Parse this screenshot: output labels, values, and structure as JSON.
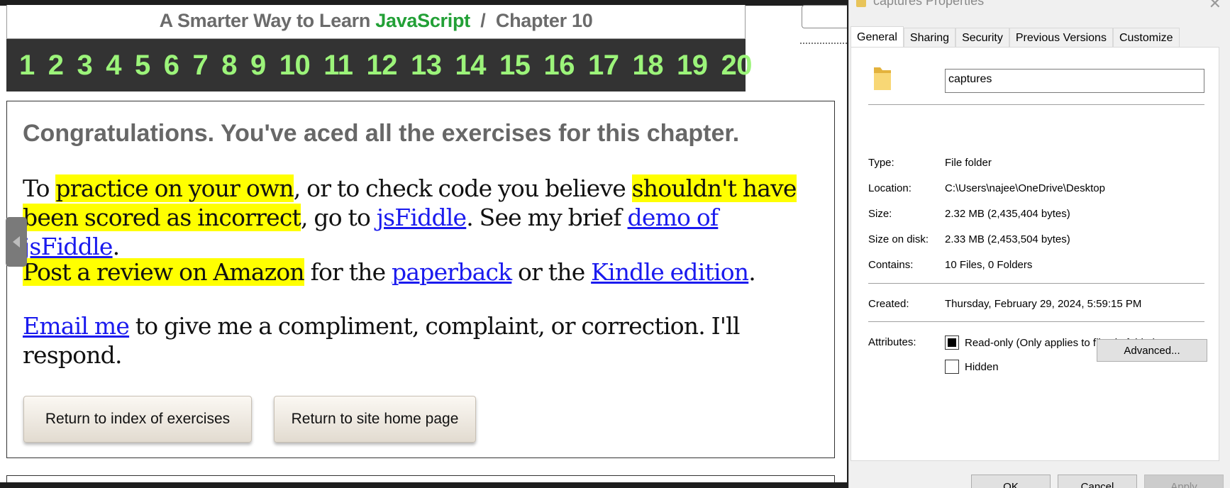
{
  "browser": {
    "header": {
      "title_prefix": "A Smarter Way to Learn ",
      "title_brand": "JavaScript",
      "title_suffix": "  /  Chapter 10"
    },
    "chapters": [
      "1",
      "2",
      "3",
      "4",
      "5",
      "6",
      "7",
      "8",
      "9",
      "10",
      "11",
      "12",
      "13",
      "14",
      "15",
      "16",
      "17",
      "18",
      "19",
      "20"
    ],
    "content": {
      "congrats": "Congratulations. You've aced all the exercises for this chapter.",
      "p1": {
        "t1": "To ",
        "h1": "practice on your own",
        "t2": ", or to check code you believe ",
        "h2": "shouldn't have been scored as incorrect",
        "t3": ", go to ",
        "link1": "jsFiddle",
        "t4": ". See my brief ",
        "link2": "demo of jsFiddle",
        "t5": "."
      },
      "p2": {
        "h1": "Post a review on Amazon",
        "t1": " for the ",
        "link1": "paperback",
        "t2": " or the ",
        "link2": "Kindle edition",
        "t3": "."
      },
      "p3": {
        "link1": "Email me",
        "t1": " to give me a compliment, complaint, or correction. I'll respond."
      },
      "buttons": {
        "index": "Return to index of exercises",
        "home": "Return to site home page"
      }
    },
    "highlight_color": "#ffff00",
    "chapter_color": "#9cf47a",
    "brand_color": "#22a036"
  },
  "dialog": {
    "title": "captures Properties",
    "tabs": [
      "General",
      "Sharing",
      "Security",
      "Previous Versions",
      "Customize"
    ],
    "active_tab": "General",
    "name": "captures",
    "rows": {
      "type": {
        "label": "Type:",
        "value": "File folder"
      },
      "location": {
        "label": "Location:",
        "value": "C:\\Users\\najee\\OneDrive\\Desktop"
      },
      "size": {
        "label": "Size:",
        "value": "2.32 MB (2,435,404 bytes)"
      },
      "size_on_disk": {
        "label": "Size on disk:",
        "value": "2.33 MB (2,453,504 bytes)"
      },
      "contains": {
        "label": "Contains:",
        "value": "10 Files, 0 Folders"
      },
      "created": {
        "label": "Created:",
        "value": "Thursday, February 29, 2024, 5:59:15 PM"
      }
    },
    "attributes": {
      "label": "Attributes:",
      "readonly": "Read-only (Only applies to files in folder)",
      "hidden": "Hidden",
      "advanced": "Advanced..."
    },
    "buttons": {
      "ok": "OK",
      "cancel": "Cancel",
      "apply": "Apply"
    }
  }
}
